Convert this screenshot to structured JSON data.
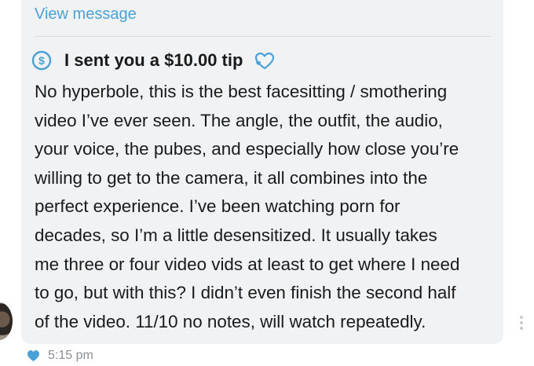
{
  "message": {
    "view_message_link": "View message",
    "tip_text": "I sent you a $10.00 tip",
    "body": "No hyperbole, this is the best facesitting / smothering\nvideo I’ve ever seen. The angle, the outfit, the audio,\nyour voice, the pubes, and especially how close you’re\nwilling to get to the camera, it all combines into the\nperfect experience. I’ve been watching porn for\ndecades, so I’m a little desensitized. It usually takes\nme three or four video vids at least to get where I need\nto go, but with this? I didn’t even finish the second half\nof the video. 11/10 no notes, will watch repeatedly.",
    "timestamp": "5:15 pm"
  },
  "icons": {
    "tip": "dollar-circle-icon",
    "tip_reaction": "heart-outline-icon",
    "liked": "heart-filled-icon",
    "more": "more-vertical-icon"
  },
  "colors": {
    "accent": "#4aa1d6",
    "bubble_bg": "#f1f2f3",
    "text": "#1a1a1a",
    "muted": "#8a8f96"
  }
}
